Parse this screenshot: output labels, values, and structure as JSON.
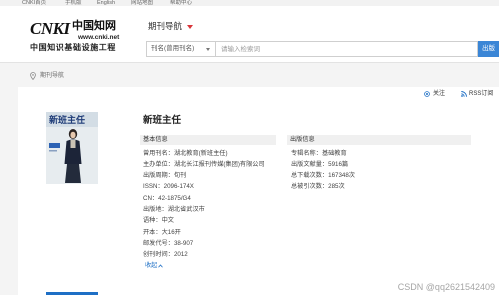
{
  "top_bar": {
    "links": [
      "CNKI首页",
      "手机版",
      "English",
      "网站地图",
      "帮助中心"
    ]
  },
  "logo": {
    "brand": "CNKI",
    "name_cn": "中国知网",
    "url": "www.cnki.net",
    "tagline": "中国知识基础设施工程"
  },
  "header": {
    "nav_title": "期刊导航"
  },
  "search": {
    "field_selected": "刊名(曾用刊名)",
    "placeholder": "请输入检索词",
    "button_label": "出版"
  },
  "breadcrumb": {
    "current": "期刊导航"
  },
  "actions": {
    "follow_label": "关注",
    "rss_label": "RSS订阅"
  },
  "journal": {
    "title": "新班主任",
    "cover": {
      "title": "新班主任"
    },
    "basic_info_heading": "基本信息",
    "basic_info": [
      {
        "label": "曾用刊名：",
        "value": "湖北教育(新班主任)"
      },
      {
        "label": "主办单位：",
        "value": "湖北长江报刊传媒(集团)有限公司"
      },
      {
        "label": "出版周期：",
        "value": "旬刊"
      },
      {
        "label": "ISSN：",
        "value": "2096-174X"
      },
      {
        "label": "CN：",
        "value": "42-1875/G4"
      },
      {
        "label": "出版地：",
        "value": "湖北省武汉市"
      },
      {
        "label": "语种：",
        "value": "中文"
      },
      {
        "label": "开本：",
        "value": "大16开"
      },
      {
        "label": "邮发代号：",
        "value": "38-907"
      },
      {
        "label": "创刊时间：",
        "value": "2012"
      }
    ],
    "collapse_label": "收起",
    "publication_info_heading": "出版信息",
    "publication_info": [
      {
        "label": "专辑名称：",
        "value": "基础教育"
      },
      {
        "label": "出版文献量：",
        "value": "5916篇"
      },
      {
        "label": "总下载次数：",
        "value": "167348次"
      },
      {
        "label": "总被引次数：",
        "value": "285次"
      }
    ]
  },
  "watermark": "CSDN @qq2621542409",
  "icons": [
    "location-pin-icon",
    "follow-icon",
    "rss-icon",
    "chevron-up-icon",
    "dropdown-arrow-icon",
    "nav-triangle-icon"
  ],
  "colors": {
    "accent": "#1e6fc5",
    "button": "#3b86d6",
    "nav_triangle": "#d9353a",
    "section_bg": "#f0f0f0",
    "page_bg": "#f4f4f4"
  }
}
